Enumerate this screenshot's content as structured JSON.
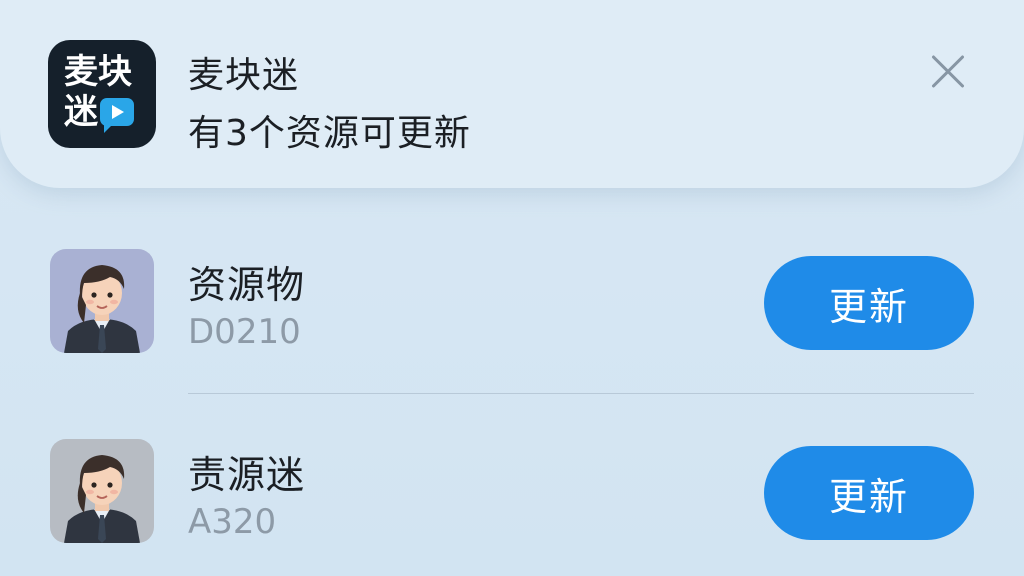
{
  "notification": {
    "app_icon": {
      "line1": "麦块",
      "line2": "迷",
      "icon": "play-bubble-icon",
      "bg_color": "#15202b",
      "accent_color": "#2aa6e8"
    },
    "title": "麦块迷",
    "subtitle": "有3个资源可更新",
    "close_icon": "close-icon"
  },
  "updates": [
    {
      "name": "资源物",
      "version": "D0210",
      "button_label": "更新",
      "avatar_icon": "person-avatar"
    },
    {
      "name": "责源迷",
      "version": "A320",
      "button_label": "更新",
      "avatar_icon": "person-avatar"
    }
  ],
  "colors": {
    "background": "#d6e6f3",
    "button": "#1f8be8",
    "secondary_text": "#8d9aa7"
  }
}
